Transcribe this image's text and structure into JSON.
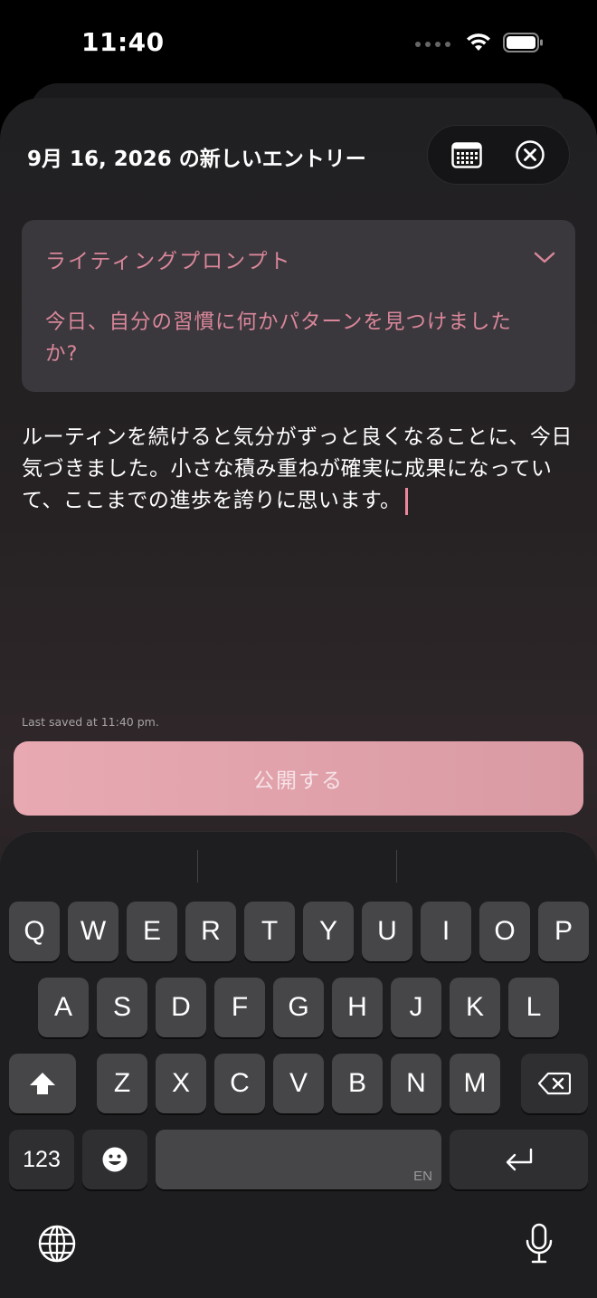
{
  "status_bar": {
    "time": "11:40"
  },
  "header": {
    "title": "9月 16, 2026 の新しいエントリー"
  },
  "icons": {
    "calendar": "calendar-icon",
    "close": "close-circle-icon",
    "chevron": "chevron-down-icon",
    "wifi": "wifi-icon",
    "battery": "battery-icon",
    "shift": "shift-icon",
    "delete": "delete-icon",
    "emoji": "emoji-icon",
    "return": "return-icon",
    "globe": "globe-icon",
    "mic": "microphone-icon"
  },
  "prompt": {
    "label": "ライティングプロンプト",
    "text": "今日、自分の習慣に何かパターンを見つけましたか?"
  },
  "entry": {
    "body": "ルーティンを続けると気分がずっと良くなることに、今日気づきました。小さな積み重ねが確実に成果になっていて、ここまでの進歩を誇りに思います。",
    "last_saved": "Last saved at 11:40 pm."
  },
  "publish_button": {
    "label": "公開する"
  },
  "keyboard": {
    "row1": [
      "Q",
      "W",
      "E",
      "R",
      "T",
      "Y",
      "U",
      "I",
      "O",
      "P"
    ],
    "row2": [
      "A",
      "S",
      "D",
      "F",
      "G",
      "H",
      "J",
      "K",
      "L"
    ],
    "row3": [
      "Z",
      "X",
      "C",
      "V",
      "B",
      "N",
      "M"
    ],
    "numbers_key": "123",
    "space_lang": "EN"
  },
  "colors": {
    "accent": "#d9869a",
    "button": "#e8a9b2",
    "card": "#3a383c"
  }
}
